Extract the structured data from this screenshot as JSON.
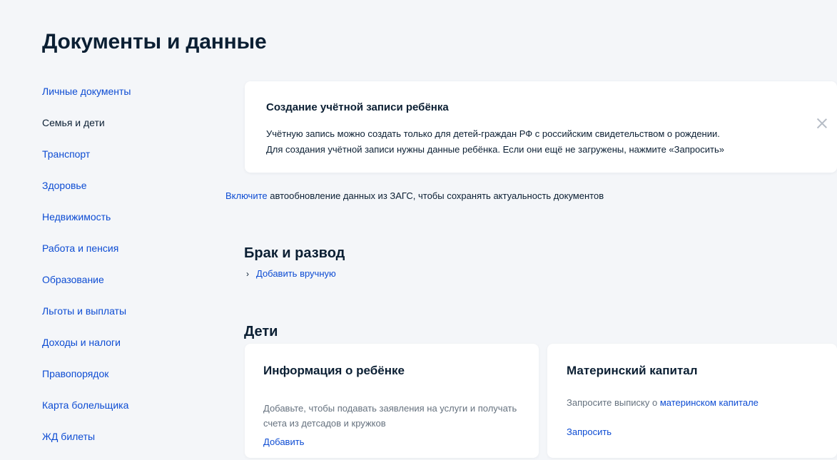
{
  "page": {
    "title": "Документы и данные"
  },
  "sidebar": {
    "items": [
      {
        "label": "Личные документы"
      },
      {
        "label": "Семья и дети"
      },
      {
        "label": "Транспорт"
      },
      {
        "label": "Здоровье"
      },
      {
        "label": "Недвижимость"
      },
      {
        "label": "Работа и пенсия"
      },
      {
        "label": "Образование"
      },
      {
        "label": "Льготы и выплаты"
      },
      {
        "label": "Доходы и налоги"
      },
      {
        "label": "Правопорядок"
      },
      {
        "label": "Карта болельщика"
      },
      {
        "label": "ЖД билеты"
      }
    ],
    "active": "Семья и дети"
  },
  "notice": {
    "title": "Создание учётной записи ребёнка",
    "line1": "Учётную запись можно создать только для детей-граждан РФ с российским свидетельством о рождении.",
    "line2": "Для создания учётной записи нужны данные ребёнка. Если они ещё не загружены, нажмите «Запросить»",
    "close_icon": "close-icon"
  },
  "autoupdate": {
    "link": "Включите",
    "text": " автообновление данных из ЗАГС, чтобы сохранять актуальность документов"
  },
  "marriage": {
    "title": "Брак и развод",
    "chevron": "›",
    "add_label": "Добавить вручную"
  },
  "children": {
    "title": "Дети",
    "child_card": {
      "title": "Информация о ребёнке",
      "text": "Добавьте, чтобы подавать заявления на услуги и получать счета из детсадов и кружков",
      "action": "Добавить"
    },
    "capital_card": {
      "title": "Материнский капитал",
      "text_prefix": "Запросите выписку о ",
      "text_link": "материнском капитале",
      "action": "Запросить"
    }
  },
  "colors": {
    "background": "#f4f6f9",
    "link": "#0d4cd3",
    "text": "#0b1f33",
    "muted": "#66727f",
    "card": "#ffffff"
  }
}
